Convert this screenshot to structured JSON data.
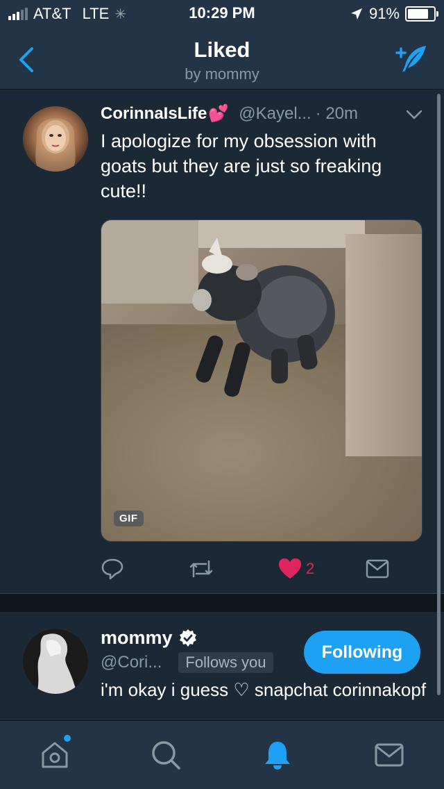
{
  "status_bar": {
    "carrier": "AT&T",
    "network": "LTE",
    "time": "10:29 PM",
    "battery": "91%",
    "battery_level": 0.91
  },
  "nav": {
    "title": "Liked",
    "subtitle": "by mommy",
    "back_icon": "chevron-left-icon",
    "compose_icon": "compose-tweet-icon"
  },
  "tweet": {
    "name": "CorinnaIsLife",
    "name_emoji": "💕",
    "handle": "@Kayel...",
    "time": "· 20m",
    "text": "I apologize for my obsession with goats but they are just so freaking cute!!",
    "media_badge": "GIF",
    "actions": {
      "reply_icon": "reply-icon",
      "retweet_icon": "retweet-icon",
      "like_icon": "heart-icon",
      "like_count": "2",
      "dm_icon": "envelope-icon"
    }
  },
  "user_card": {
    "name": "mommy",
    "handle": "@Cori...",
    "follows_you": "Follows you",
    "follow_button": "Following",
    "bio": "i'm okay i guess ♡ snapchat corinnakopf"
  },
  "tab_bar": {
    "items": [
      "home-icon",
      "search-icon",
      "notifications-icon",
      "messages-icon"
    ]
  },
  "colors": {
    "background": "#1b2836",
    "bar": "#243447",
    "accent": "#1da1f2",
    "like": "#e0245e",
    "secondary_text": "#8899a6"
  }
}
